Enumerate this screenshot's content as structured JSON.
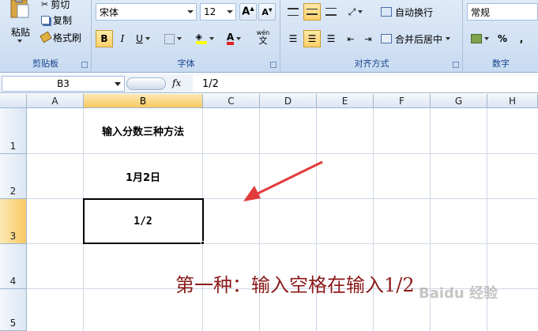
{
  "ribbon": {
    "clipboard": {
      "paste_label": "粘贴",
      "cut_label": "剪切",
      "copy_label": "复制",
      "format_painter_label": "格式刷",
      "group_label": "剪贴板"
    },
    "font": {
      "font_name": "宋体",
      "font_size": "12",
      "bold": "B",
      "italic": "I",
      "underline": "U",
      "font_color_glyph": "A",
      "wen": "wén",
      "wen_char": "文",
      "group_label": "字体"
    },
    "alignment": {
      "wrap_label": "自动换行",
      "merge_label": "合并后居中",
      "group_label": "对齐方式"
    },
    "number": {
      "format_value": "常规",
      "percent": "%",
      "comma": ",",
      "group_label": "数字"
    }
  },
  "formula_bar": {
    "name_box": "B3",
    "fx_label": "fx",
    "content": "1/2"
  },
  "sheet": {
    "columns": [
      "A",
      "B",
      "C",
      "D",
      "E",
      "F",
      "G",
      "H"
    ],
    "rows": [
      "1",
      "2",
      "3",
      "4",
      "5"
    ],
    "cells": {
      "B1": "输入分数三种方法",
      "B2": "1月2日",
      "B3": "1/2"
    },
    "selected_cell": "B3"
  },
  "annotation": "第一种：输入空格在输入1/2",
  "watermark": "Baidu 经验",
  "colors": {
    "annotation": "#8b1a1a",
    "arrow": "#e23b3b",
    "selected_header": "#f7c963"
  }
}
